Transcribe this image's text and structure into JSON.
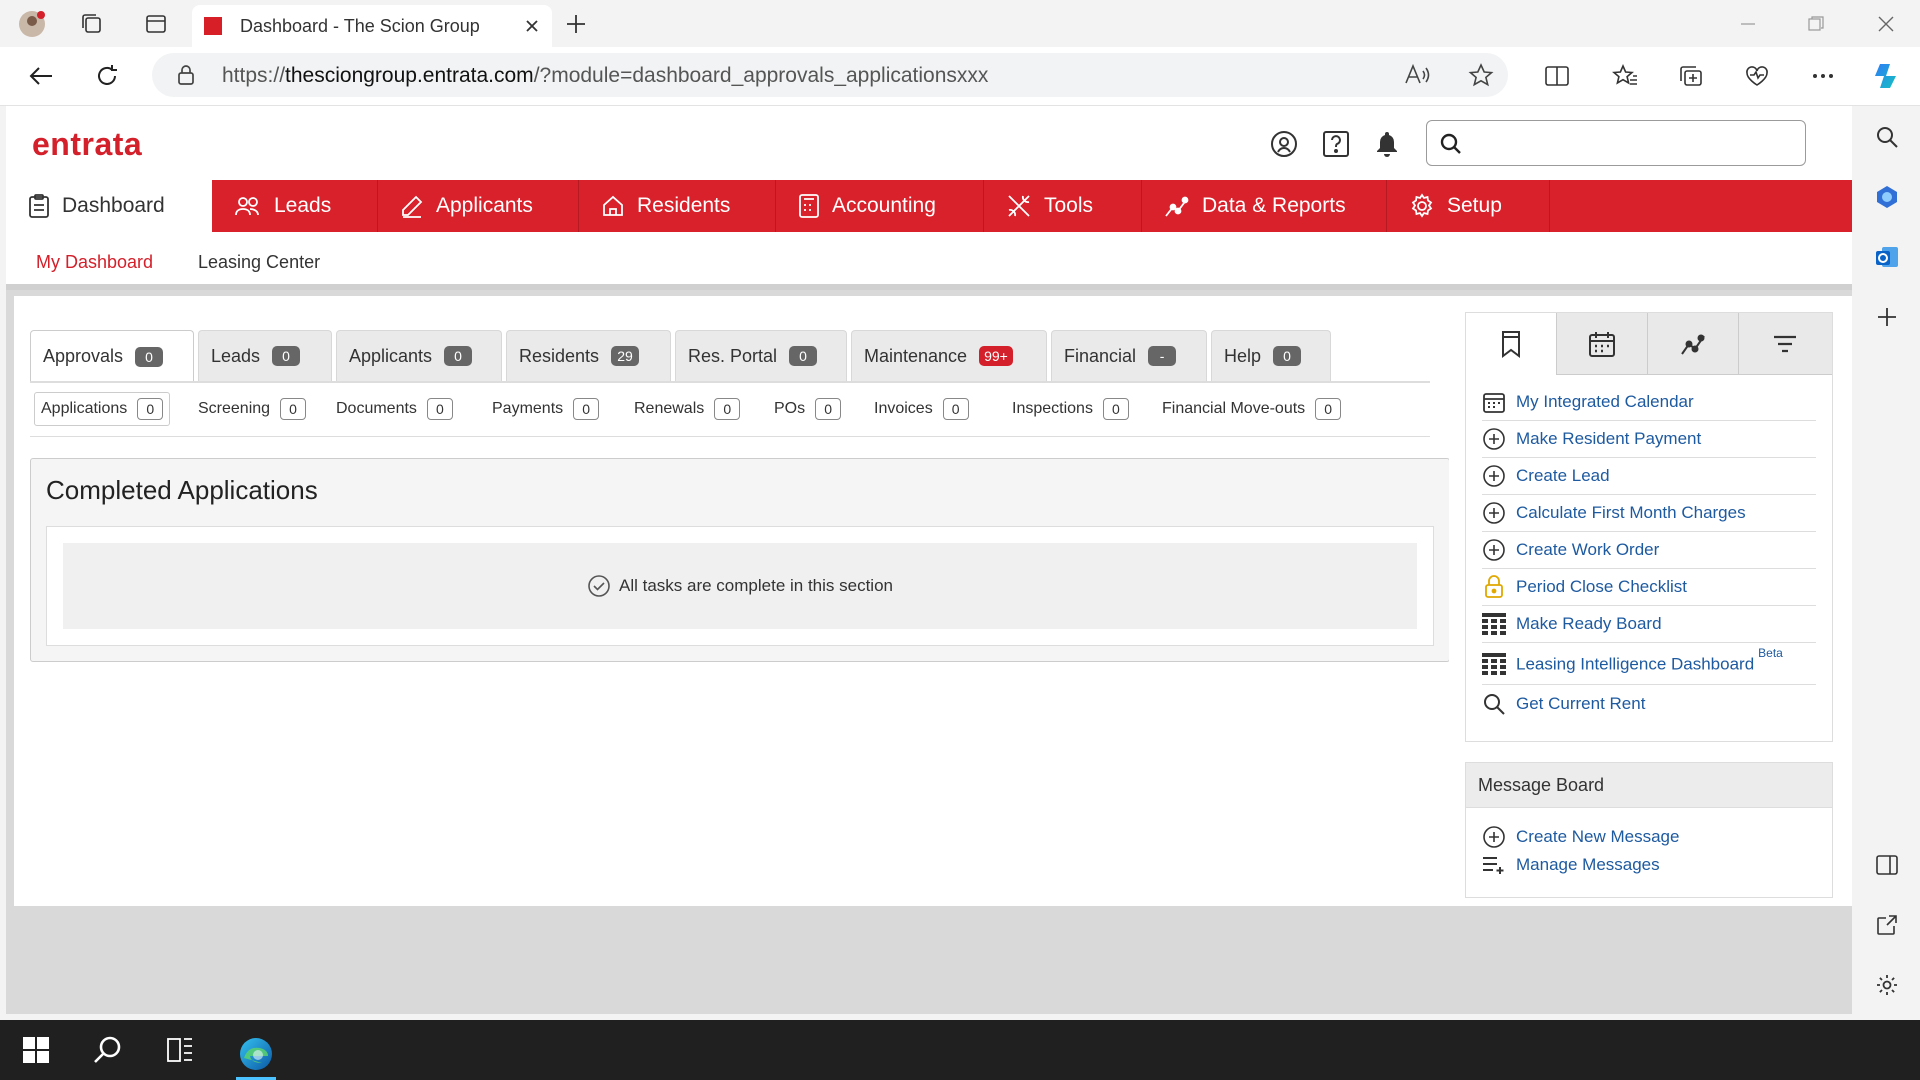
{
  "browser": {
    "tab_title": "Dashboard - The Scion Group",
    "url_prefix": "https://",
    "url_host": "thesciongroup.entrata.com",
    "url_path": "/?module=dashboard_approvals_applicationsxxx"
  },
  "header": {
    "logo": "entrata",
    "search_placeholder": ""
  },
  "nav": {
    "items": [
      {
        "label": "Dashboard",
        "icon": "clipboard-icon"
      },
      {
        "label": "Leads",
        "icon": "people-icon"
      },
      {
        "label": "Applicants",
        "icon": "pen-icon"
      },
      {
        "label": "Residents",
        "icon": "home-icon"
      },
      {
        "label": "Accounting",
        "icon": "calculator-icon"
      },
      {
        "label": "Tools",
        "icon": "tools-icon"
      },
      {
        "label": "Data & Reports",
        "icon": "chart-icon"
      },
      {
        "label": "Setup",
        "icon": "gear-icon"
      }
    ],
    "subnav": [
      "My Dashboard",
      "Leasing Center"
    ]
  },
  "tabs": [
    {
      "label": "Approvals",
      "count": "0"
    },
    {
      "label": "Leads",
      "count": "0"
    },
    {
      "label": "Applicants",
      "count": "0"
    },
    {
      "label": "Residents",
      "count": "29"
    },
    {
      "label": "Res. Portal",
      "count": "0"
    },
    {
      "label": "Maintenance",
      "count": "99+"
    },
    {
      "label": "Financial",
      "count": "-"
    },
    {
      "label": "Help",
      "count": "0"
    }
  ],
  "subtabs": [
    {
      "label": "Applications",
      "count": "0"
    },
    {
      "label": "Screening",
      "count": "0"
    },
    {
      "label": "Documents",
      "count": "0"
    },
    {
      "label": "Payments",
      "count": "0"
    },
    {
      "label": "Renewals",
      "count": "0"
    },
    {
      "label": "POs",
      "count": "0"
    },
    {
      "label": "Invoices",
      "count": "0"
    },
    {
      "label": "Inspections",
      "count": "0"
    },
    {
      "label": "Financial Move-outs",
      "count": "0"
    }
  ],
  "panel": {
    "title": "Completed Applications",
    "message": "All tasks are complete in this section"
  },
  "quick_links": [
    {
      "label": "My Integrated Calendar",
      "icon": "calendar-icon"
    },
    {
      "label": "Make Resident Payment",
      "icon": "plus-circle-icon"
    },
    {
      "label": "Create Lead",
      "icon": "plus-circle-icon"
    },
    {
      "label": "Calculate First Month Charges",
      "icon": "plus-circle-icon"
    },
    {
      "label": "Create Work Order",
      "icon": "plus-circle-icon"
    },
    {
      "label": "Period Close Checklist",
      "icon": "lock-icon"
    },
    {
      "label": "Make Ready Board",
      "icon": "grid-icon"
    },
    {
      "label": "Leasing Intelligence Dashboard",
      "icon": "grid-icon",
      "sup": "Beta"
    },
    {
      "label": "Get Current Rent",
      "icon": "search-icon"
    }
  ],
  "message_board": {
    "title": "Message Board",
    "items": [
      "Create New Message",
      "Manage Messages"
    ]
  },
  "colors": {
    "brand": "#d9212b",
    "link": "#1e5aa0"
  }
}
